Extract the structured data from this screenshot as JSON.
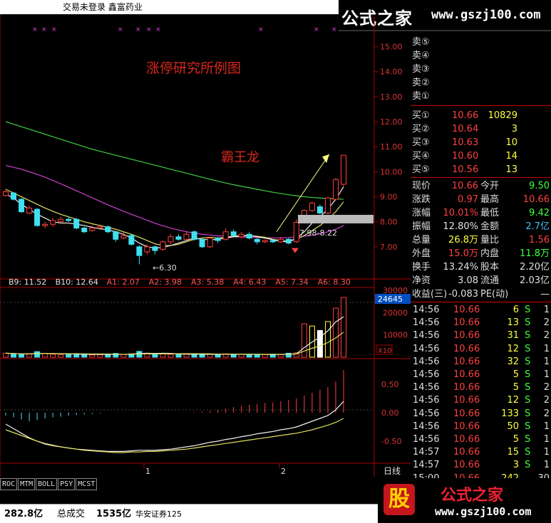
{
  "window": {
    "title": "交易未登录  鑫富药业"
  },
  "watermark": {
    "logo": "公式之家",
    "site": "www.gszj100.com",
    "badge": "股"
  },
  "annotations": {
    "study_title": "涨停研究所例图",
    "pattern_name": "霸王龙",
    "low_label": "←6.30",
    "range_label": "7.98-8.22"
  },
  "price_axis": {
    "ticks": [
      "15.00",
      "14.00",
      "13.00",
      "12.00",
      "11.00",
      "10.00",
      "9.00",
      "8.00",
      "7.00"
    ]
  },
  "ma_legend": [
    {
      "label": "B9: 11.52",
      "color": "#e0e0e0"
    },
    {
      "label": "B10: 12.64",
      "color": "#e0e0e0"
    },
    {
      "label": "A1: 2.07",
      "color": "#ff5555"
    },
    {
      "label": "A2: 3.98",
      "color": "#ff5555"
    },
    {
      "label": "A3: 5.38",
      "color": "#ff5555"
    },
    {
      "label": "A4: 6.43",
      "color": "#ff5555"
    },
    {
      "label": "A5: 7.34",
      "color": "#ff5555"
    },
    {
      "label": "A6: 8.30",
      "color": "#ff5555"
    }
  ],
  "volume_axis": {
    "ticks": [
      "30000",
      "20000",
      "10000"
    ],
    "current": "24645",
    "unit": "X10"
  },
  "macd_axis": {
    "ticks": [
      "0.50",
      "0.00",
      "-0.50"
    ]
  },
  "period_label": "日线",
  "x_labels": [
    "1",
    "2"
  ],
  "indicator_tabs": [
    "ROC",
    "MTM",
    "BOLL",
    "PSY",
    "MCST"
  ],
  "status": {
    "amount": "282.8亿",
    "total_label": "总成交",
    "total_value": "1535亿",
    "broker": "华安证券125"
  },
  "orderbook": {
    "sells": [
      {
        "label": "卖⑤",
        "price": "",
        "vol": ""
      },
      {
        "label": "卖④",
        "price": "",
        "vol": ""
      },
      {
        "label": "卖③",
        "price": "",
        "vol": ""
      },
      {
        "label": "卖②",
        "price": "",
        "vol": ""
      },
      {
        "label": "卖①",
        "price": "",
        "vol": ""
      }
    ],
    "buys": [
      {
        "label": "买①",
        "price": "10.66",
        "vol": "10829"
      },
      {
        "label": "买②",
        "price": "10.64",
        "vol": "3"
      },
      {
        "label": "买③",
        "price": "10.63",
        "vol": "10"
      },
      {
        "label": "买④",
        "price": "10.60",
        "vol": "14"
      },
      {
        "label": "买⑤",
        "price": "10.56",
        "vol": "13"
      }
    ]
  },
  "stats": [
    {
      "l1": "现价",
      "v1": "10.66",
      "c1": "#ff4040",
      "l2": "今开",
      "v2": "9.50",
      "c2": "#40ff40"
    },
    {
      "l1": "涨跌",
      "v1": "0.97",
      "c1": "#ff4040",
      "l2": "最高",
      "v2": "10.66",
      "c2": "#ff4040"
    },
    {
      "l1": "涨幅",
      "v1": "10.01%",
      "c1": "#ff4040",
      "l2": "最低",
      "v2": "9.42",
      "c2": "#40ff40"
    },
    {
      "l1": "振幅",
      "v1": "12.80%",
      "c1": "#e0e0e0",
      "l2": "金额",
      "v2": "2.7亿",
      "c2": "#40c0ff"
    },
    {
      "l1": "总量",
      "v1": "26.8万",
      "c1": "#ffff40",
      "l2": "量比",
      "v2": "1.56",
      "c2": "#ff4040"
    },
    {
      "l1": "外盘",
      "v1": "15.0万",
      "c1": "#ff4040",
      "l2": "内盘",
      "v2": "11.8万",
      "c2": "#40ff40"
    },
    {
      "l1": "换手",
      "v1": "13.24%",
      "c1": "#e0e0e0",
      "l2": "股本",
      "v2": "2.20亿",
      "c2": "#e0e0e0"
    },
    {
      "l1": "净资",
      "v1": "3.08",
      "c1": "#e0e0e0",
      "l2": "流通",
      "v2": "2.03亿",
      "c2": "#e0e0e0"
    },
    {
      "l1": "收益(三)",
      "v1": "-0.083",
      "c1": "#e0e0e0",
      "l2": "PE(动)",
      "v2": "—",
      "c2": "#e0e0e0"
    }
  ],
  "ticks": [
    {
      "time": "14:56",
      "price": "10.66",
      "vol": "6",
      "side": "S",
      "n": "1"
    },
    {
      "time": "14:56",
      "price": "10.66",
      "vol": "13",
      "side": "S",
      "n": "2"
    },
    {
      "time": "14:56",
      "price": "10.66",
      "vol": "31",
      "side": "S",
      "n": "2"
    },
    {
      "time": "14:56",
      "price": "10.66",
      "vol": "12",
      "side": "S",
      "n": "1"
    },
    {
      "time": "14:56",
      "price": "10.66",
      "vol": "32",
      "side": "S",
      "n": "1"
    },
    {
      "time": "14:56",
      "price": "10.66",
      "vol": "5",
      "side": "S",
      "n": "1"
    },
    {
      "time": "14:56",
      "price": "10.66",
      "vol": "5",
      "side": "S",
      "n": "2"
    },
    {
      "time": "14:56",
      "price": "10.66",
      "vol": "12",
      "side": "S",
      "n": "2"
    },
    {
      "time": "14:56",
      "price": "10.66",
      "vol": "133",
      "side": "S",
      "n": "2"
    },
    {
      "time": "14:56",
      "price": "10.66",
      "vol": "50",
      "side": "S",
      "n": "1"
    },
    {
      "time": "14:56",
      "price": "10.66",
      "vol": "5",
      "side": "S",
      "n": "1"
    },
    {
      "time": "14:57",
      "price": "10.66",
      "vol": "15",
      "side": "S",
      "n": "1"
    },
    {
      "time": "14:57",
      "price": "10.66",
      "vol": "3",
      "side": "S",
      "n": "1"
    },
    {
      "time": "15:00",
      "price": "10.66",
      "vol": "242",
      "side": "",
      "n": "30"
    }
  ],
  "chart_data": {
    "type": "candlestick",
    "ylim": [
      6.0,
      15.5
    ],
    "candles": [
      {
        "o": 9.05,
        "c": 9.2,
        "h": 9.3,
        "l": 9.0
      },
      {
        "o": 9.15,
        "c": 8.9,
        "h": 9.2,
        "l": 8.85
      },
      {
        "o": 8.9,
        "c": 8.4,
        "h": 8.95,
        "l": 8.35
      },
      {
        "o": 8.35,
        "c": 8.55,
        "h": 8.65,
        "l": 8.3
      },
      {
        "o": 8.5,
        "c": 7.85,
        "h": 8.55,
        "l": 7.8
      },
      {
        "o": 7.85,
        "c": 7.9,
        "h": 8.0,
        "l": 7.75
      },
      {
        "o": 7.9,
        "c": 8.05,
        "h": 8.15,
        "l": 7.8
      },
      {
        "o": 8.0,
        "c": 8.1,
        "h": 8.2,
        "l": 7.95
      },
      {
        "o": 8.1,
        "c": 8.05,
        "h": 8.2,
        "l": 8.0
      },
      {
        "o": 8.1,
        "c": 7.75,
        "h": 8.15,
        "l": 7.7
      },
      {
        "o": 7.75,
        "c": 7.6,
        "h": 7.8,
        "l": 7.55
      },
      {
        "o": 7.65,
        "c": 7.75,
        "h": 7.85,
        "l": 7.6
      },
      {
        "o": 7.75,
        "c": 7.8,
        "h": 7.9,
        "l": 7.7
      },
      {
        "o": 7.8,
        "c": 7.6,
        "h": 7.85,
        "l": 7.55
      },
      {
        "o": 7.6,
        "c": 7.3,
        "h": 7.65,
        "l": 7.2
      },
      {
        "o": 7.35,
        "c": 7.45,
        "h": 7.6,
        "l": 7.3
      },
      {
        "o": 7.45,
        "c": 7.1,
        "h": 7.5,
        "l": 7.05
      },
      {
        "o": 7.0,
        "c": 6.65,
        "h": 7.05,
        "l": 6.3
      },
      {
        "o": 6.8,
        "c": 7.0,
        "h": 7.1,
        "l": 6.7
      },
      {
        "o": 7.0,
        "c": 6.85,
        "h": 7.05,
        "l": 6.7
      },
      {
        "o": 6.9,
        "c": 7.2,
        "h": 7.25,
        "l": 6.85
      },
      {
        "o": 7.2,
        "c": 7.4,
        "h": 7.5,
        "l": 7.1
      },
      {
        "o": 7.4,
        "c": 7.3,
        "h": 7.5,
        "l": 7.25
      },
      {
        "o": 7.3,
        "c": 7.5,
        "h": 7.6,
        "l": 7.25
      },
      {
        "o": 7.6,
        "c": 7.3,
        "h": 7.65,
        "l": 7.25
      },
      {
        "o": 7.3,
        "c": 7.0,
        "h": 7.35,
        "l": 6.95
      },
      {
        "o": 7.0,
        "c": 7.35,
        "h": 7.4,
        "l": 6.95
      },
      {
        "o": 7.35,
        "c": 7.25,
        "h": 7.4,
        "l": 7.15
      },
      {
        "o": 7.3,
        "c": 7.6,
        "h": 7.75,
        "l": 7.25
      },
      {
        "o": 7.6,
        "c": 7.45,
        "h": 7.7,
        "l": 7.4
      },
      {
        "o": 7.4,
        "c": 7.5,
        "h": 7.6,
        "l": 7.35
      },
      {
        "o": 7.5,
        "c": 7.35,
        "h": 7.6,
        "l": 7.3
      },
      {
        "o": 7.3,
        "c": 7.2,
        "h": 7.35,
        "l": 7.1
      },
      {
        "o": 7.2,
        "c": 7.25,
        "h": 7.3,
        "l": 7.15
      },
      {
        "o": 7.25,
        "c": 7.2,
        "h": 7.3,
        "l": 7.15
      },
      {
        "o": 7.2,
        "c": 7.3,
        "h": 7.4,
        "l": 7.15
      },
      {
        "o": 7.3,
        "c": 7.15,
        "h": 7.35,
        "l": 7.1
      },
      {
        "o": 7.2,
        "c": 7.98,
        "h": 8.1,
        "l": 7.15
      },
      {
        "o": 8.0,
        "c": 8.45,
        "h": 8.5,
        "l": 7.95
      },
      {
        "o": 8.45,
        "c": 8.75,
        "h": 8.8,
        "l": 8.4
      },
      {
        "o": 8.6,
        "c": 8.35,
        "h": 8.7,
        "l": 8.3
      },
      {
        "o": 8.35,
        "c": 8.95,
        "h": 9.0,
        "l": 8.3
      },
      {
        "o": 8.9,
        "c": 9.69,
        "h": 9.75,
        "l": 8.85
      },
      {
        "o": 9.5,
        "c": 10.66,
        "h": 10.66,
        "l": 9.42
      }
    ],
    "ma_long": [
      12.0,
      11.9,
      11.8,
      11.7,
      11.6,
      11.5,
      11.4,
      11.3,
      11.2,
      11.1,
      11.0,
      10.9,
      10.82,
      10.74,
      10.66,
      10.58,
      10.5,
      10.42,
      10.34,
      10.26,
      10.18,
      10.1,
      10.02,
      9.94,
      9.86,
      9.78,
      9.7,
      9.62,
      9.55,
      9.48,
      9.42,
      9.36,
      9.3,
      9.24,
      9.18,
      9.13,
      9.08,
      9.04,
      9.0,
      8.97,
      8.95,
      8.93,
      8.92,
      8.9
    ],
    "ma_mid": [
      10.25,
      10.18,
      10.1,
      10.0,
      9.9,
      9.78,
      9.65,
      9.52,
      9.38,
      9.24,
      9.1,
      8.96,
      8.82,
      8.68,
      8.55,
      8.42,
      8.3,
      8.18,
      8.06,
      7.94,
      7.84,
      7.75,
      7.67,
      7.6,
      7.55,
      7.5,
      7.47,
      7.44,
      7.42,
      7.4,
      7.39,
      7.38,
      7.37,
      7.36,
      7.36,
      7.36,
      7.37,
      7.39,
      7.42,
      7.46,
      7.52,
      7.6,
      7.7,
      7.85
    ],
    "ma_short": [
      9.3,
      9.15,
      9.0,
      8.85,
      8.7,
      8.55,
      8.42,
      8.3,
      8.2,
      8.1,
      8.0,
      7.92,
      7.85,
      7.78,
      7.7,
      7.6,
      7.5,
      7.38,
      7.25,
      7.12,
      7.05,
      7.05,
      7.1,
      7.2,
      7.3,
      7.35,
      7.38,
      7.35,
      7.38,
      7.42,
      7.45,
      7.45,
      7.42,
      7.38,
      7.3,
      7.25,
      7.22,
      7.3,
      7.45,
      7.65,
      7.85,
      8.1,
      8.4,
      8.8
    ],
    "ma_fast": [
      9.1,
      8.95,
      8.7,
      8.5,
      8.3,
      8.15,
      8.0,
      7.95,
      7.95,
      7.9,
      7.85,
      7.78,
      7.72,
      7.68,
      7.6,
      7.5,
      7.35,
      7.15,
      7.0,
      6.95,
      6.98,
      7.05,
      7.15,
      7.25,
      7.35,
      7.3,
      7.28,
      7.3,
      7.35,
      7.4,
      7.42,
      7.45,
      7.4,
      7.35,
      7.28,
      7.22,
      7.2,
      7.35,
      7.6,
      7.95,
      8.2,
      8.5,
      8.9,
      9.4
    ],
    "volumes": [
      1800,
      1500,
      1200,
      1400,
      2500,
      1700,
      1300,
      1100,
      1200,
      1600,
      1400,
      1000,
      1100,
      1300,
      1700,
      1200,
      1500,
      2600,
      1800,
      1400,
      1500,
      1300,
      1200,
      1400,
      1600,
      1100,
      1300,
      1200,
      1500,
      1400,
      1300,
      1200,
      1100,
      1200,
      1400,
      1300,
      1800,
      2000,
      15000,
      14000,
      12000,
      16000,
      22000,
      26800
    ],
    "vol_ylim": [
      0,
      30000
    ],
    "macd": [
      -0.05,
      -0.08,
      -0.12,
      -0.15,
      -0.13,
      -0.1,
      -0.08,
      -0.07,
      -0.05,
      -0.04,
      -0.03,
      -0.02,
      -0.01,
      0.0,
      0.0,
      0.0,
      0.0,
      0.0,
      0.0,
      0.0,
      0.0,
      0.0,
      0.0,
      0.0,
      0.01,
      0.02,
      0.03,
      0.05,
      0.07,
      0.1,
      0.12,
      0.14,
      0.15,
      0.17,
      0.18,
      0.2,
      0.22,
      0.25,
      0.3,
      0.35,
      0.4,
      0.45,
      0.55,
      0.75
    ],
    "macd_line1": [
      -0.2,
      -0.28,
      -0.36,
      -0.44,
      -0.5,
      -0.55,
      -0.58,
      -0.6,
      -0.62,
      -0.64,
      -0.65,
      -0.66,
      -0.67,
      -0.68,
      -0.68,
      -0.68,
      -0.67,
      -0.66,
      -0.66,
      -0.66,
      -0.65,
      -0.64,
      -0.62,
      -0.6,
      -0.58,
      -0.55,
      -0.52,
      -0.5,
      -0.47,
      -0.45,
      -0.42,
      -0.4,
      -0.37,
      -0.35,
      -0.33,
      -0.3,
      -0.28,
      -0.25,
      -0.2,
      -0.15,
      -0.1,
      -0.05,
      0.05,
      0.2
    ],
    "macd_line2": [
      -0.3,
      -0.35,
      -0.4,
      -0.45,
      -0.5,
      -0.54,
      -0.57,
      -0.6,
      -0.62,
      -0.64,
      -0.66,
      -0.67,
      -0.68,
      -0.69,
      -0.7,
      -0.7,
      -0.69,
      -0.69,
      -0.68,
      -0.68,
      -0.67,
      -0.66,
      -0.65,
      -0.64,
      -0.62,
      -0.6,
      -0.58,
      -0.56,
      -0.54,
      -0.52,
      -0.5,
      -0.48,
      -0.46,
      -0.44,
      -0.42,
      -0.4,
      -0.38,
      -0.36,
      -0.33,
      -0.3,
      -0.26,
      -0.22,
      -0.17,
      -0.1
    ],
    "macd_ylim": [
      -0.85,
      0.85
    ]
  }
}
